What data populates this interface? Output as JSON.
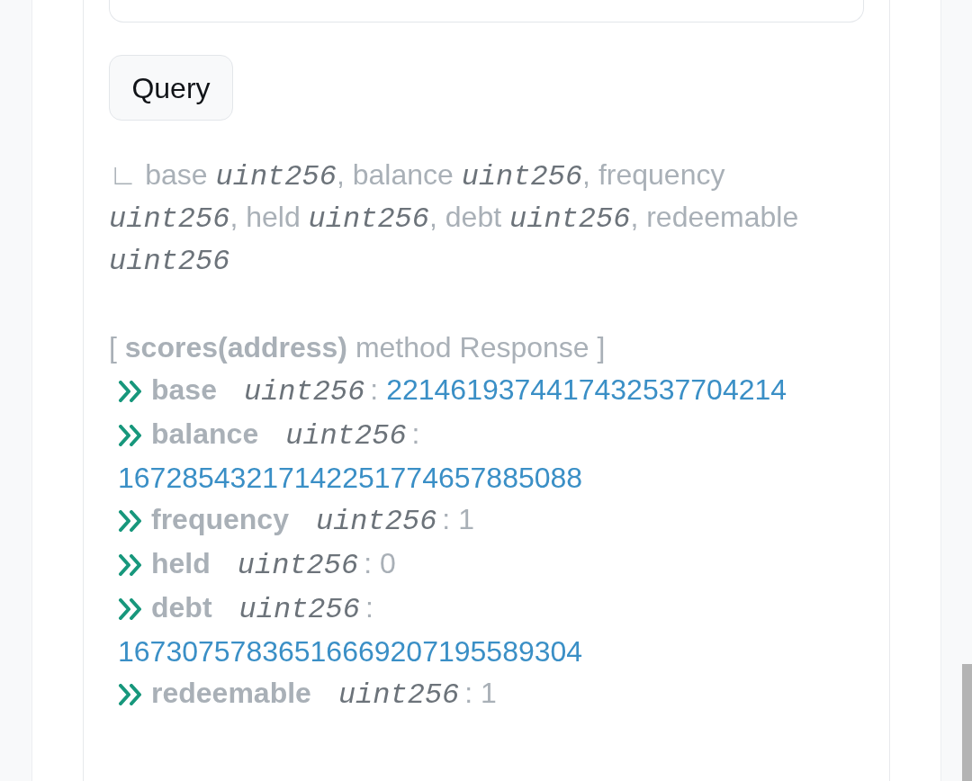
{
  "query_button": {
    "label": "Query"
  },
  "output_signature": "∟ base *uint256*, balance *uint256*, frequency *uint256*, held *uint256*, debt *uint256*, redeemable *uint256*",
  "response": {
    "title": "[ **scores(address)** method Response ]",
    "rows": [
      {
        "name": "base",
        "type": "uint256",
        "separator": ":",
        "value": "2214619374417432537704214",
        "kind": "link"
      },
      {
        "name": "balance",
        "type": "uint256",
        "separator": ":",
        "value": "16728543217142251774657885088",
        "kind": "link"
      },
      {
        "name": "frequency",
        "type": "uint256",
        "separator": ":",
        "value": "1",
        "kind": "plain"
      },
      {
        "name": "held",
        "type": "uint256",
        "separator": ":",
        "value": "0",
        "kind": "plain"
      },
      {
        "name": "debt",
        "type": "uint256",
        "separator": ":",
        "value": "16730757836516669207195589304",
        "kind": "link"
      },
      {
        "name": "redeemable",
        "type": "uint256",
        "separator": ":",
        "value": "1",
        "kind": "plain"
      }
    ]
  }
}
